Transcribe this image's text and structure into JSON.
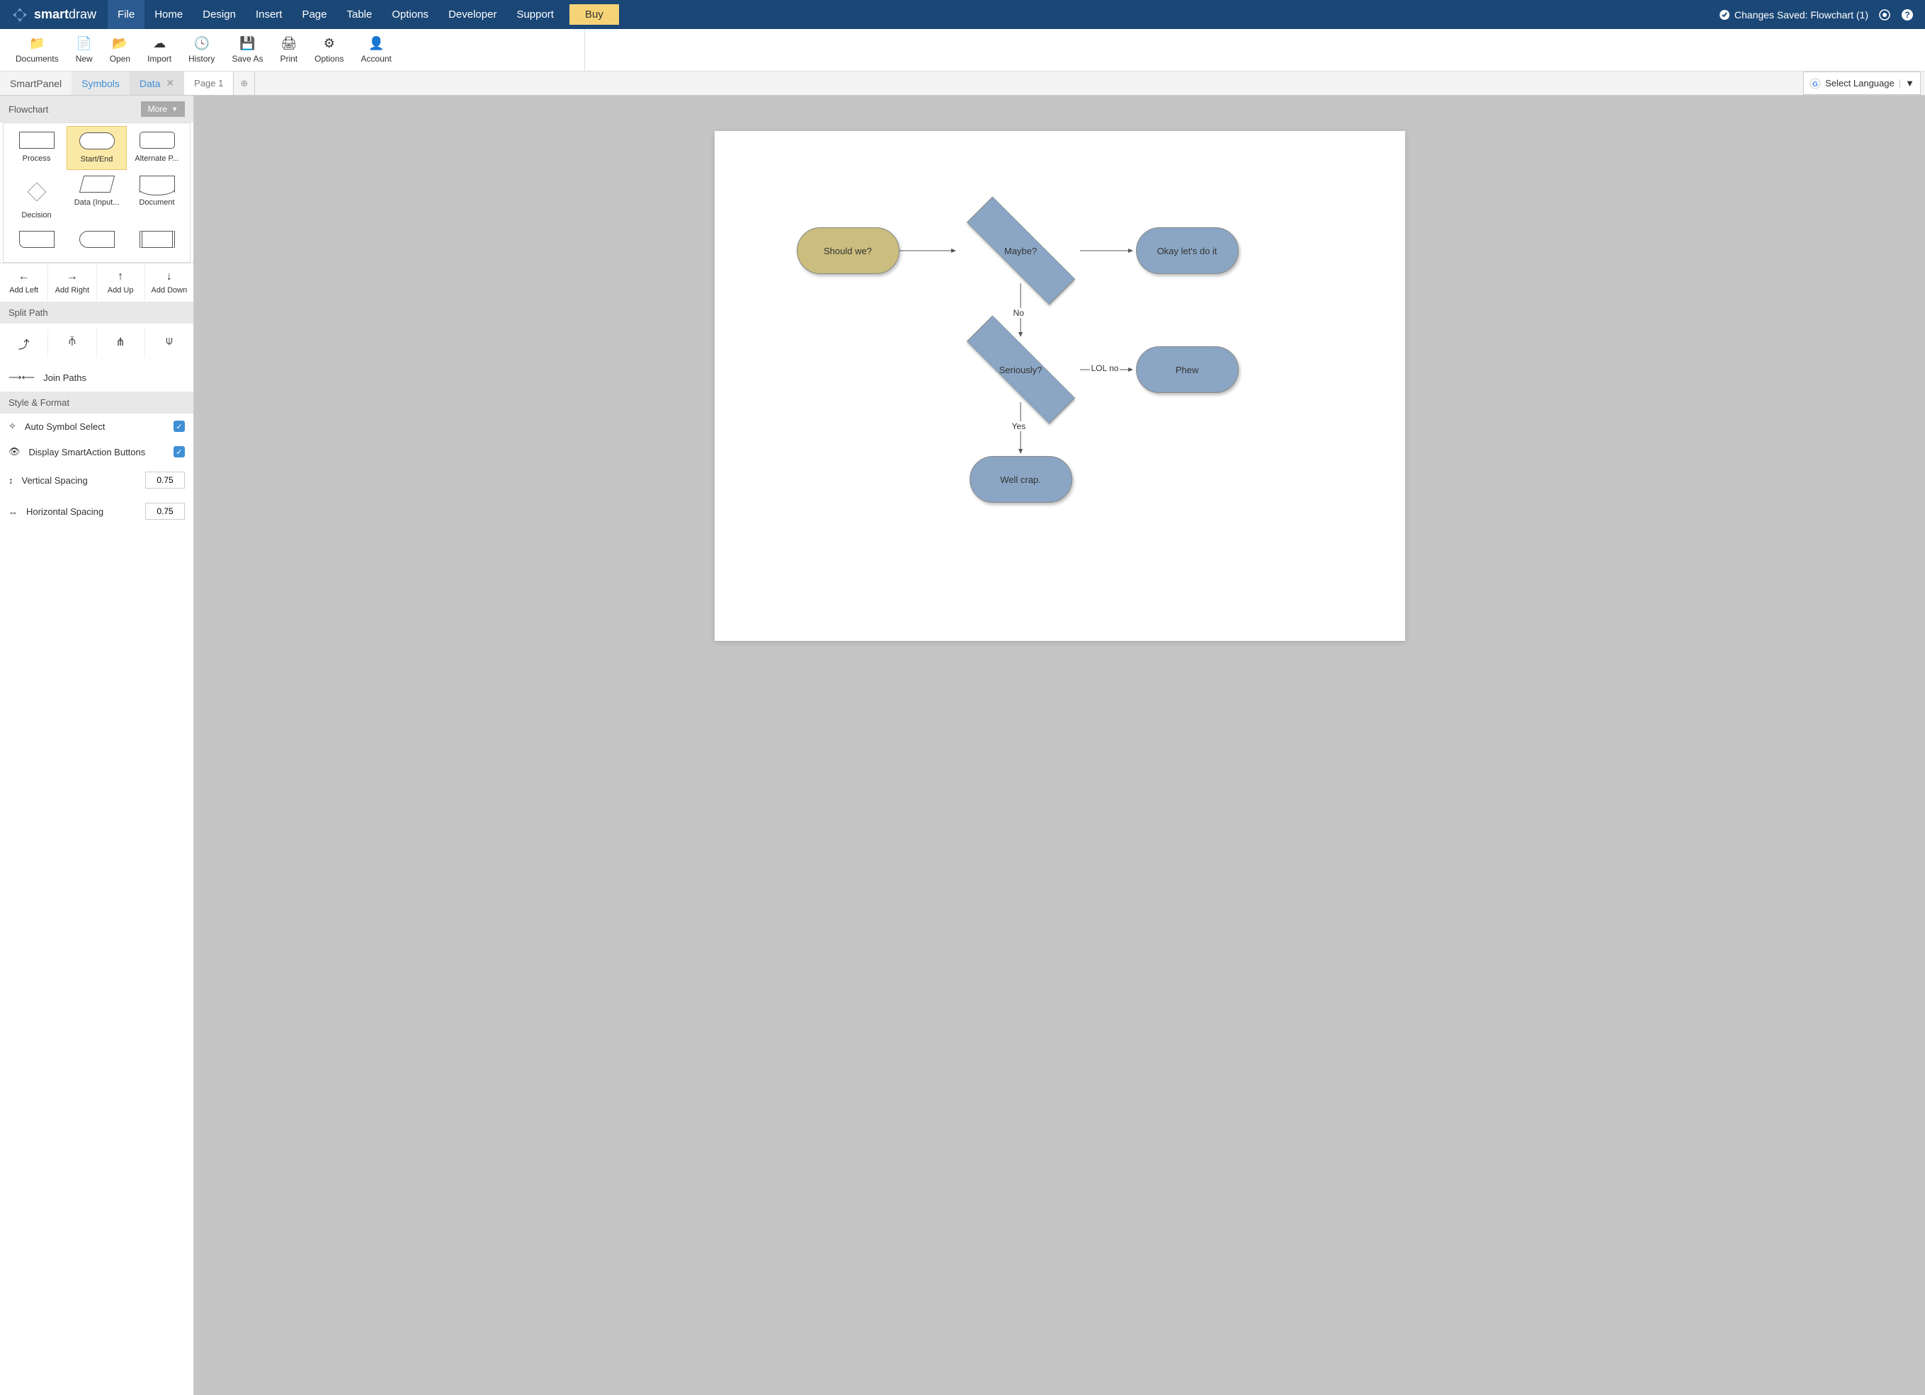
{
  "brand": {
    "name_bold": "smart",
    "name_light": "draw"
  },
  "menubar": {
    "items": [
      "File",
      "Home",
      "Design",
      "Insert",
      "Page",
      "Table",
      "Options",
      "Developer",
      "Support"
    ],
    "active": "File",
    "buy": "Buy",
    "save_status": "Changes Saved: Flowchart (1)"
  },
  "ribbon": [
    {
      "label": "Documents",
      "icon": "folder"
    },
    {
      "label": "New",
      "icon": "file"
    },
    {
      "label": "Open",
      "icon": "open"
    },
    {
      "label": "Import",
      "icon": "cloud"
    },
    {
      "label": "History",
      "icon": "clock"
    },
    {
      "label": "Save As",
      "icon": "save"
    },
    {
      "label": "Print",
      "icon": "print"
    },
    {
      "label": "Options",
      "icon": "gears"
    },
    {
      "label": "Account",
      "icon": "user"
    }
  ],
  "smartpanel": {
    "tabs": {
      "title": "SmartPanel",
      "symbols": "Symbols",
      "data": "Data"
    },
    "page_tab": "Page 1"
  },
  "language": "Select Language",
  "shapes": {
    "header": "Flowchart",
    "more": "More",
    "items": [
      {
        "label": "Process",
        "kind": "rect"
      },
      {
        "label": "Start/End",
        "kind": "rounded",
        "selected": true
      },
      {
        "label": "Alternate P...",
        "kind": "rounded"
      },
      {
        "label": "Decision",
        "kind": "diamond"
      },
      {
        "label": "Data (Input...",
        "kind": "parallelogram"
      },
      {
        "label": "Document",
        "kind": "doc"
      }
    ]
  },
  "add_dirs": [
    {
      "label": "Add Left",
      "arrow": "←"
    },
    {
      "label": "Add Right",
      "arrow": "→"
    },
    {
      "label": "Add Up",
      "arrow": "↑"
    },
    {
      "label": "Add Down",
      "arrow": "↓"
    }
  ],
  "split": {
    "header": "Split Path"
  },
  "join": {
    "label": "Join Paths"
  },
  "style": {
    "header": "Style & Format",
    "auto": "Auto Symbol Select",
    "display": "Display SmartAction Buttons",
    "vspacing_label": "Vertical Spacing",
    "hspacing_label": "Horizontal Spacing",
    "vspacing": "0.75",
    "hspacing": "0.75"
  },
  "flowchart": {
    "nodes": {
      "start": "Should we?",
      "maybe": "Maybe?",
      "ok": "Okay let's do it",
      "seriously": "Seriously?",
      "phew": "Phew",
      "crap": "Well crap."
    },
    "edges": {
      "no": "No",
      "lolno": "LOL no",
      "yes": "Yes"
    }
  }
}
